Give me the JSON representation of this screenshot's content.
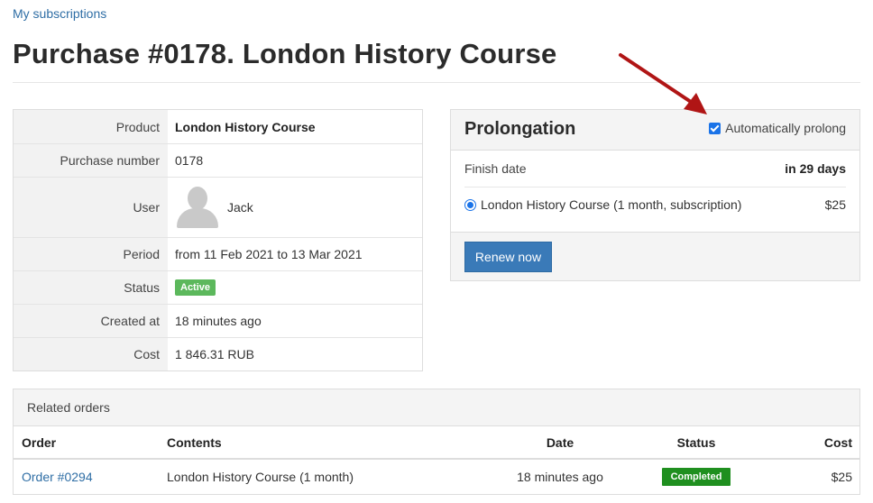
{
  "breadcrumb": "My subscriptions",
  "page_title": "Purchase #0178. London History Course",
  "details": {
    "product_label": "Product",
    "product_value": "London History Course",
    "purchase_number_label": "Purchase number",
    "purchase_number_value": "0178",
    "user_label": "User",
    "user_value": "Jack",
    "period_label": "Period",
    "period_value": "from 11 Feb 2021 to 13 Mar 2021",
    "status_label": "Status",
    "status_value": "Active",
    "created_label": "Created at",
    "created_value": "18 minutes ago",
    "cost_label": "Cost",
    "cost_value": "1 846.31 RUB"
  },
  "prolongation": {
    "title": "Prolongation",
    "auto_prolong_label": "Automatically prolong",
    "auto_prolong_checked": true,
    "finish_label": "Finish date",
    "finish_value": "in 29 days",
    "plan_label": "London History Course (1 month, subscription)",
    "plan_price": "$25",
    "renew_button": "Renew now"
  },
  "related_orders": {
    "title": "Related orders",
    "columns": [
      "Order",
      "Contents",
      "Date",
      "Status",
      "Cost"
    ],
    "rows": [
      {
        "order": "Order #0294",
        "contents": "London History Course (1 month)",
        "date": "18 minutes ago",
        "status": "Completed",
        "cost": "$25"
      }
    ]
  },
  "colors": {
    "link": "#2f6ea5",
    "active_badge": "#5cb85c",
    "completed_badge": "#1f8f1f",
    "primary_button": "#3a7ab8",
    "annotation_arrow": "#b01515"
  }
}
